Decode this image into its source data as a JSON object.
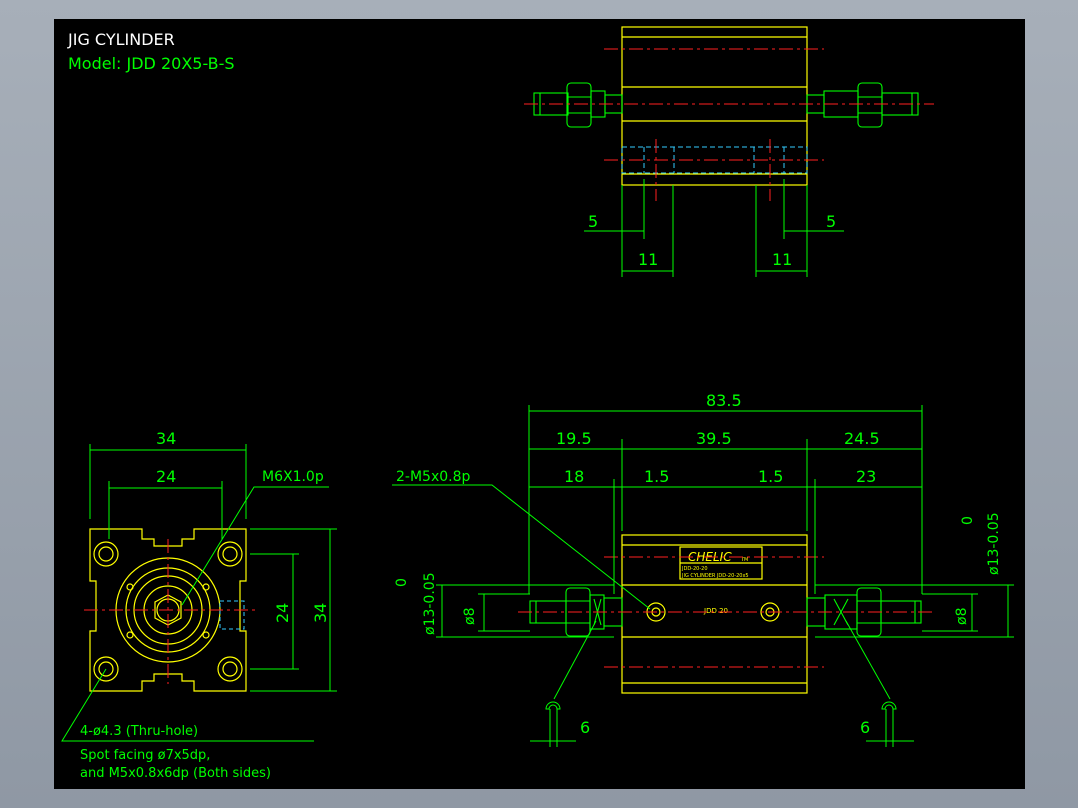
{
  "colors": {
    "background": "#000000",
    "outline": "#ffff00",
    "dimension": "#00ff00",
    "center_line": "#ff2020",
    "hidden": "#33ccff",
    "title": "#ffffff"
  },
  "title": {
    "line1": "JIG CYLINDER",
    "line2": "Model:  JDD 20X5-B-S"
  },
  "top_view": {
    "dim_left_5": "5",
    "dim_right_5": "5",
    "dim_left_11": "11",
    "dim_right_11": "11"
  },
  "end_view": {
    "dim_width_34": "34",
    "dim_width_24": "24",
    "dim_height_24": "24",
    "dim_height_34": "34",
    "thread_callout": "M6X1.0p",
    "hole_callout": "4-ø4.3 (Thru-hole)",
    "note_line1": "Spot facing ø7x5dp,",
    "note_line2": "and M5x0.8x6dp (Both sides)"
  },
  "front_view": {
    "dim_overall": "83.5",
    "dim_19_5": "19.5",
    "dim_39_5": "39.5",
    "dim_24_5": "24.5",
    "dim_18": "18",
    "dim_1_5_left": "1.5",
    "dim_1_5_right": "1.5",
    "dim_23": "23",
    "port_callout": "2-M5x0.8p",
    "rod_dia_left": "ø13-0.05",
    "rod_tol_left": "0",
    "rod_dia_right": "ø13-0.05",
    "rod_tol_right": "0",
    "shaft_dia_left": "ø8",
    "shaft_dia_right": "ø8",
    "wrench_left": "6",
    "wrench_right": "6",
    "label_brand": "CHELIC",
    "label_brand_suffix": "TM",
    "label_line1": "JDD-20-20",
    "label_line2": "JIG CYLINDER JDD-20-20x5",
    "body_text": "JDD 20"
  }
}
